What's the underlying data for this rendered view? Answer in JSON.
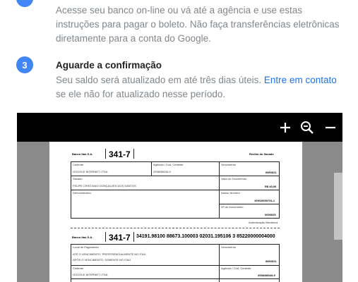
{
  "steps": [
    {
      "text": "Acesse seu banco on-line ou vá até a agência e use estas instruções para pagar o boleto. Não faça transferências eletrônicas diretamente para a conta do Google."
    },
    {
      "number": "3",
      "title": "Aguarde a confirmação",
      "text_before": "Seu saldo será atualizado em até três dias úteis. ",
      "link": "Entre em contato",
      "text_after": " se ele não for atualizado nesse período."
    }
  ],
  "viewer": {
    "icons": {
      "zoom_in": "plus-icon",
      "zoom_out": "magnifier-minus-icon",
      "collapse": "minus-icon"
    }
  },
  "boleto": {
    "bank": "Banco Itaú S.A.",
    "code": "341-7",
    "receipt": "Recibo do Sacado",
    "cedente_label": "Cedente",
    "cedente": "GOOGLE INTERNET LTDA",
    "agencia_label": "Agência / Cód. Cedente",
    "agencia": "2938/38043-9",
    "vencimento_label": "Vencimento",
    "vencimento": "09/03/21",
    "sacado_label": "Sacado",
    "sacado": "FELIPE CRISTIANO GONÇALVES DOS SANTOS",
    "valor_label": "Valor do Documento",
    "valor": "R$ 40,00",
    "demonstrativo_label": "Demonstrativo",
    "nosso_numero_label": "Nosso Número",
    "nosso_numero": "109/10000731-1",
    "documento_label": "Nº do Documento",
    "documento": "0000025",
    "autenticacao": "Autenticação Mecânica",
    "linha_digitavel": "34191.98100 88673.100003 02031.195106 3 85220000004000",
    "local_label": "Local de Pagamento",
    "local_1": "ATÉ O VENCIMENTO, PREFERENCIALMENTE NO ITAÚ",
    "local_2": "APÓS O VENCIMENTO, SOMENTE NO ITAÚ",
    "cedente2": "GOOGLE INTERNET LTDA",
    "agencia2": "2938/38043-9"
  }
}
